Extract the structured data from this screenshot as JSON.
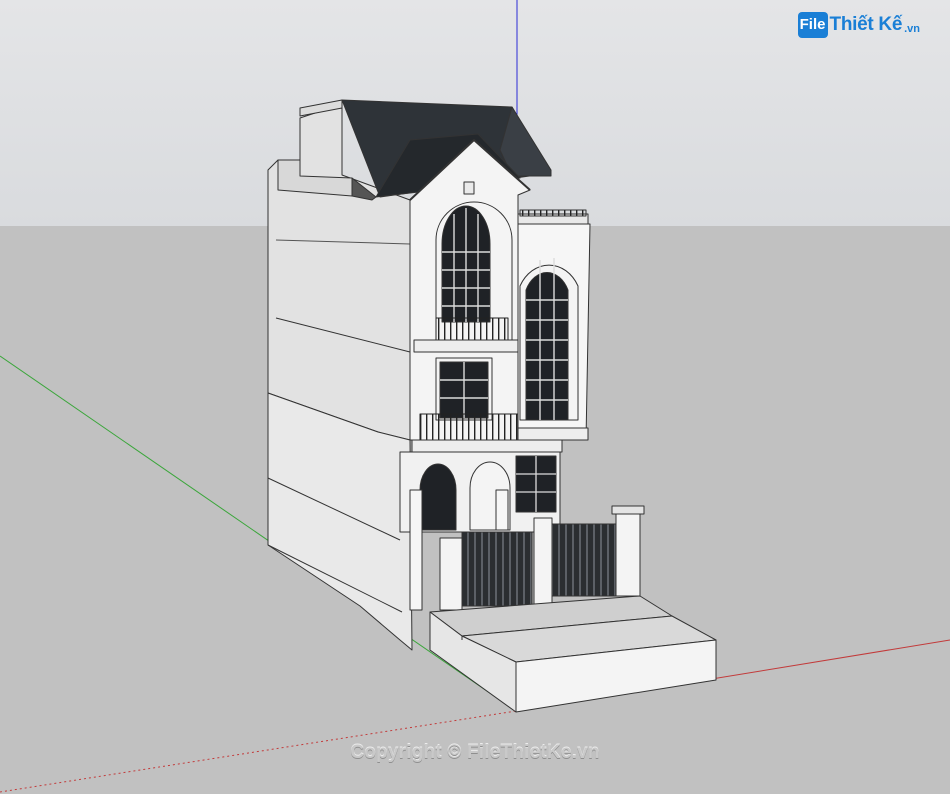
{
  "watermark": {
    "logo_mark": "File",
    "logo_text": "Thiết Kế",
    "logo_suffix": ".vn",
    "copyright": "Copyright © FileThietKe.vn"
  },
  "colors": {
    "sky": "#dfe1e4",
    "ground": "#c1c1c1",
    "axis_red": "#c23a3a",
    "axis_green": "#3aa63a",
    "axis_blue": "#2b2bd6",
    "roof": "#2e3338",
    "wall": "#f4f4f4",
    "window_glass": "#1f2226",
    "brand": "#1a7fd6"
  },
  "icons": [
    "model-origin-axes",
    "house-3d-model",
    "filethietke-logo"
  ]
}
